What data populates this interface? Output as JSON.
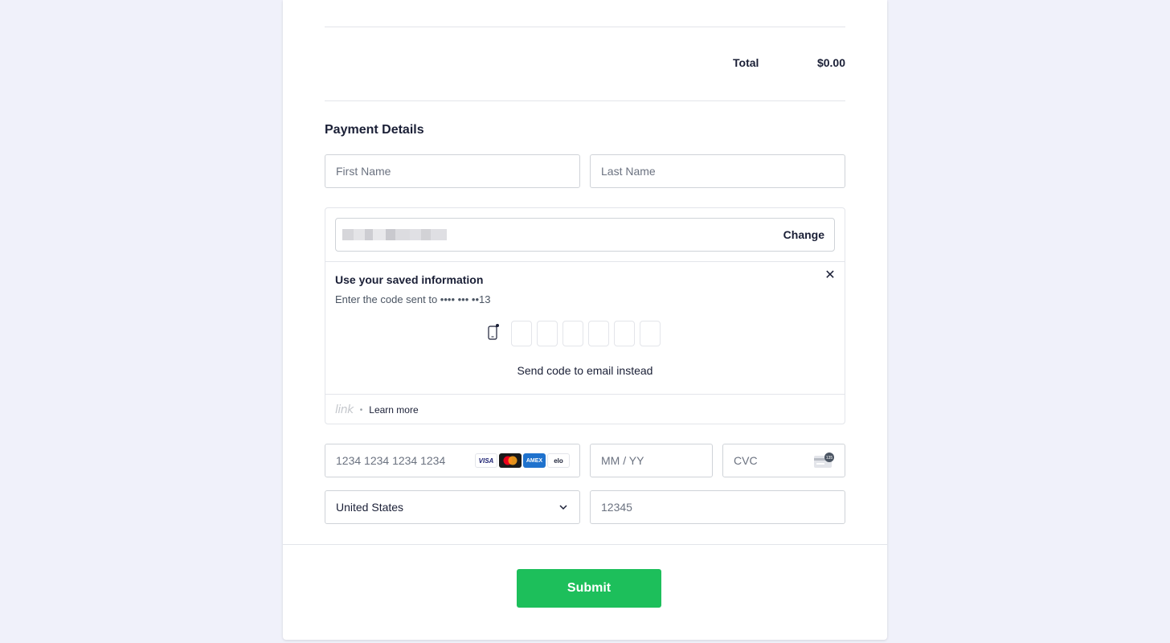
{
  "summary": {
    "total_label": "Total",
    "total_value": "$0.00"
  },
  "payment": {
    "title": "Payment Details",
    "first_name_placeholder": "First Name",
    "last_name_placeholder": "Last Name"
  },
  "link": {
    "change_label": "Change",
    "saved_title": "Use your saved information",
    "saved_subtitle": "Enter the code sent to •••• ••• ••13",
    "close_glyph": "✕",
    "send_email_label": "Send code to email instead",
    "logo_text": "link",
    "dot": "•",
    "learn_more": "Learn more"
  },
  "card": {
    "number_placeholder": "1234 1234 1234 1234",
    "expiry_placeholder": "MM / YY",
    "cvc_placeholder": "CVC",
    "brands": [
      "VISA",
      "mastercard",
      "AMEX",
      "elo"
    ]
  },
  "address": {
    "country": "United States",
    "zip_placeholder": "12345"
  },
  "submit_label": "Submit",
  "colors": {
    "accent": "#1dbf5b",
    "background": "#f0f1fa"
  }
}
